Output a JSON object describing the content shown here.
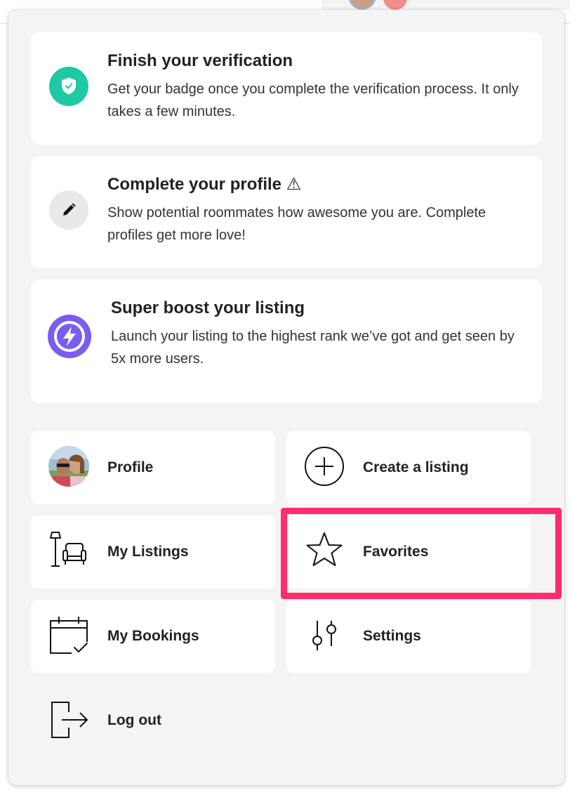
{
  "promos": [
    {
      "title": "Finish your verification",
      "body": "Get your badge once you complete the verification process. It only takes a few minutes.",
      "icon": "shield-check-icon",
      "icon_bg": "#1ec9a4"
    },
    {
      "title": "Complete your profile ⚠",
      "body": "Show potential roommates how awesome you are. Complete profiles get more love!",
      "icon": "pencil-icon",
      "icon_bg": "#e9e9e9"
    },
    {
      "title": "Super boost your listing",
      "body": "Launch your listing to the highest rank we’ve got and get seen by 5x more users.",
      "icon": "lightning-bolt-icon",
      "icon_bg": "#7b5cf0"
    }
  ],
  "menu": {
    "profile": "Profile",
    "create_listing": "Create a listing",
    "my_listings": "My Listings",
    "favorites": "Favorites",
    "my_bookings": "My Bookings",
    "settings": "Settings",
    "log_out": "Log out"
  },
  "colors": {
    "highlight": "#ff2d6f",
    "menu_bg": "#f4f4f4"
  }
}
